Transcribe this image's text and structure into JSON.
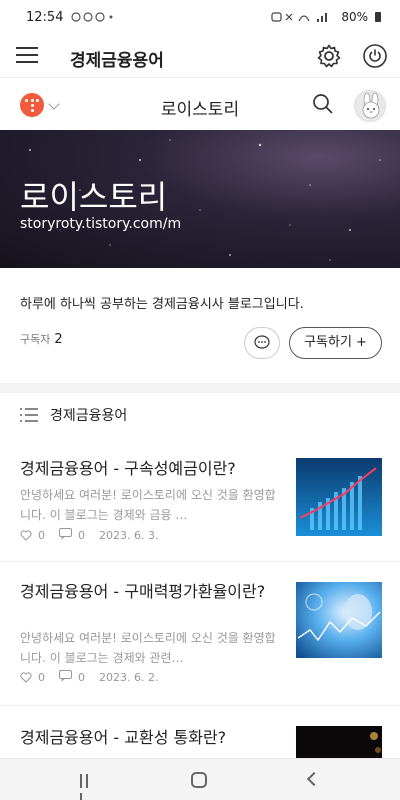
{
  "status": {
    "time": "12:54",
    "battery": "80%"
  },
  "app": {
    "title": "경제금융용어"
  },
  "blog": {
    "name": "로이스토리",
    "cover_title": "로이스토리",
    "url": "storyroty.tistory.com/m",
    "description": "하루에 하나씩 공부하는 경제금융시사 블로그입니다.",
    "subscribers_label": "구독자",
    "subscribers_count": "2",
    "subscribe_button": "구독하기 +"
  },
  "category": {
    "label": "경제금융용어"
  },
  "posts": [
    {
      "title": "경제금융용어 - 구속성예금이란?",
      "excerpt": "안녕하세요 여러분! 로이스토리에 오신 것을 환영합니다. 이 블로그는 경제와 금융 …",
      "likes": "0",
      "comments": "0",
      "date": "2023. 6. 3."
    },
    {
      "title": "경제금융용어 - 구매력평가환율이란?",
      "excerpt": "안녕하세요 여러분! 로이스토리에 오신 것을 환영합니다. 이 블로그는 경제와 관련…",
      "likes": "0",
      "comments": "0",
      "date": "2023. 6. 2."
    },
    {
      "title": "경제금융용어 - 교환성 통화란?"
    }
  ],
  "icons": {
    "menu": "hamburger-icon",
    "settings": "gear-icon",
    "power": "power-icon",
    "blog_logo": "tistory-logo",
    "search": "search-icon",
    "avatar": "rabbit-avatar",
    "chat": "chat-icon",
    "list": "list-icon",
    "like": "heart-icon",
    "comment": "comment-icon"
  },
  "colors": {
    "tistory_logo": "#f15b3b",
    "thumb1": "#1a6fb0",
    "thumb2": "#2a8fd0"
  }
}
